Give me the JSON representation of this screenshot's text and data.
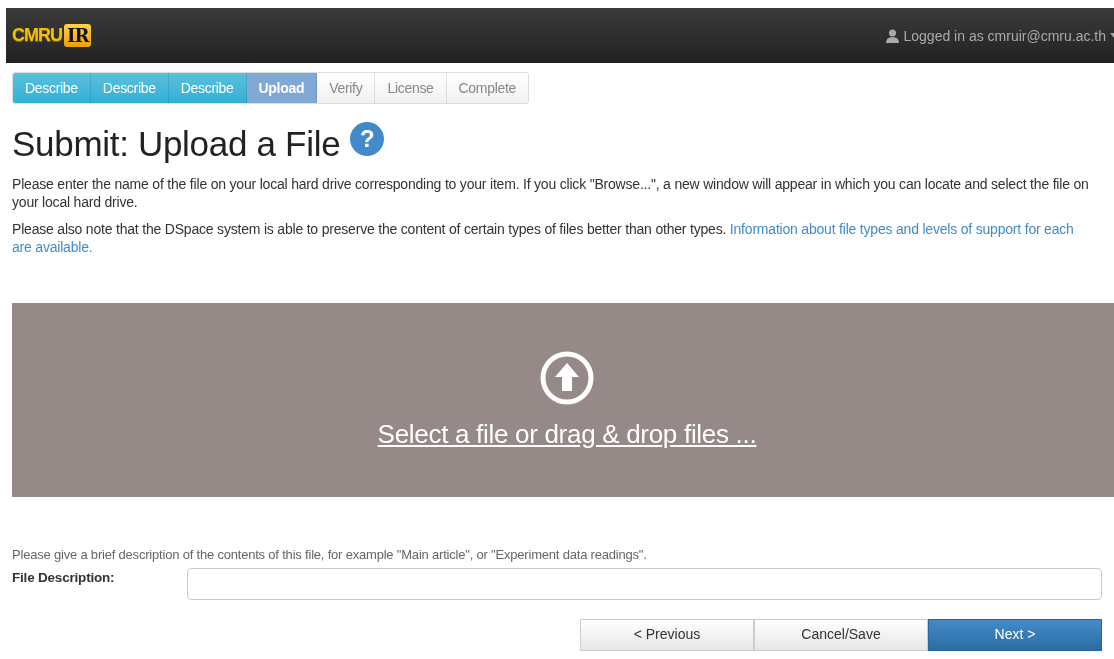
{
  "header": {
    "logo": {
      "text": "CMRU",
      "badge": "IR"
    },
    "user": "Logged in as cmruir@cmru.ac.th"
  },
  "steps": [
    {
      "label": "Describe",
      "kind": "done",
      "selected": false
    },
    {
      "label": "Describe",
      "kind": "done",
      "selected": false
    },
    {
      "label": "Describe",
      "kind": "done",
      "selected": false
    },
    {
      "label": "Upload",
      "kind": "current",
      "selected": true
    },
    {
      "label": "Verify",
      "kind": "todo",
      "selected": false
    },
    {
      "label": "License",
      "kind": "todo",
      "selected": false
    },
    {
      "label": "Complete",
      "kind": "todo",
      "selected": false
    }
  ],
  "title": "Submit: Upload a File",
  "help_icon": "?",
  "intro": "Please enter the name of the file on your local hard drive corresponding to your item. If you click \"Browse...\", a new window will appear in which you can locate and select the file on your local hard drive.",
  "note": {
    "text": "Please also note that the DSpace system is able to preserve the content of certain types of files better than other types.",
    "link": [
      "Information about file types and levels of support for each",
      "are available."
    ]
  },
  "dropzone": {
    "label": "Select a file or drag & drop files ..."
  },
  "description_hint": "Please give a brief description of the contents of this file, for example \"Main article\", or \"Experiment data readings\".",
  "file_description": {
    "label": "File Description:"
  },
  "buttons": [
    {
      "label": "< Previous",
      "kind": "default"
    },
    {
      "label": "Cancel/Save",
      "kind": "default"
    },
    {
      "label": "Next >",
      "kind": "primary"
    }
  ]
}
